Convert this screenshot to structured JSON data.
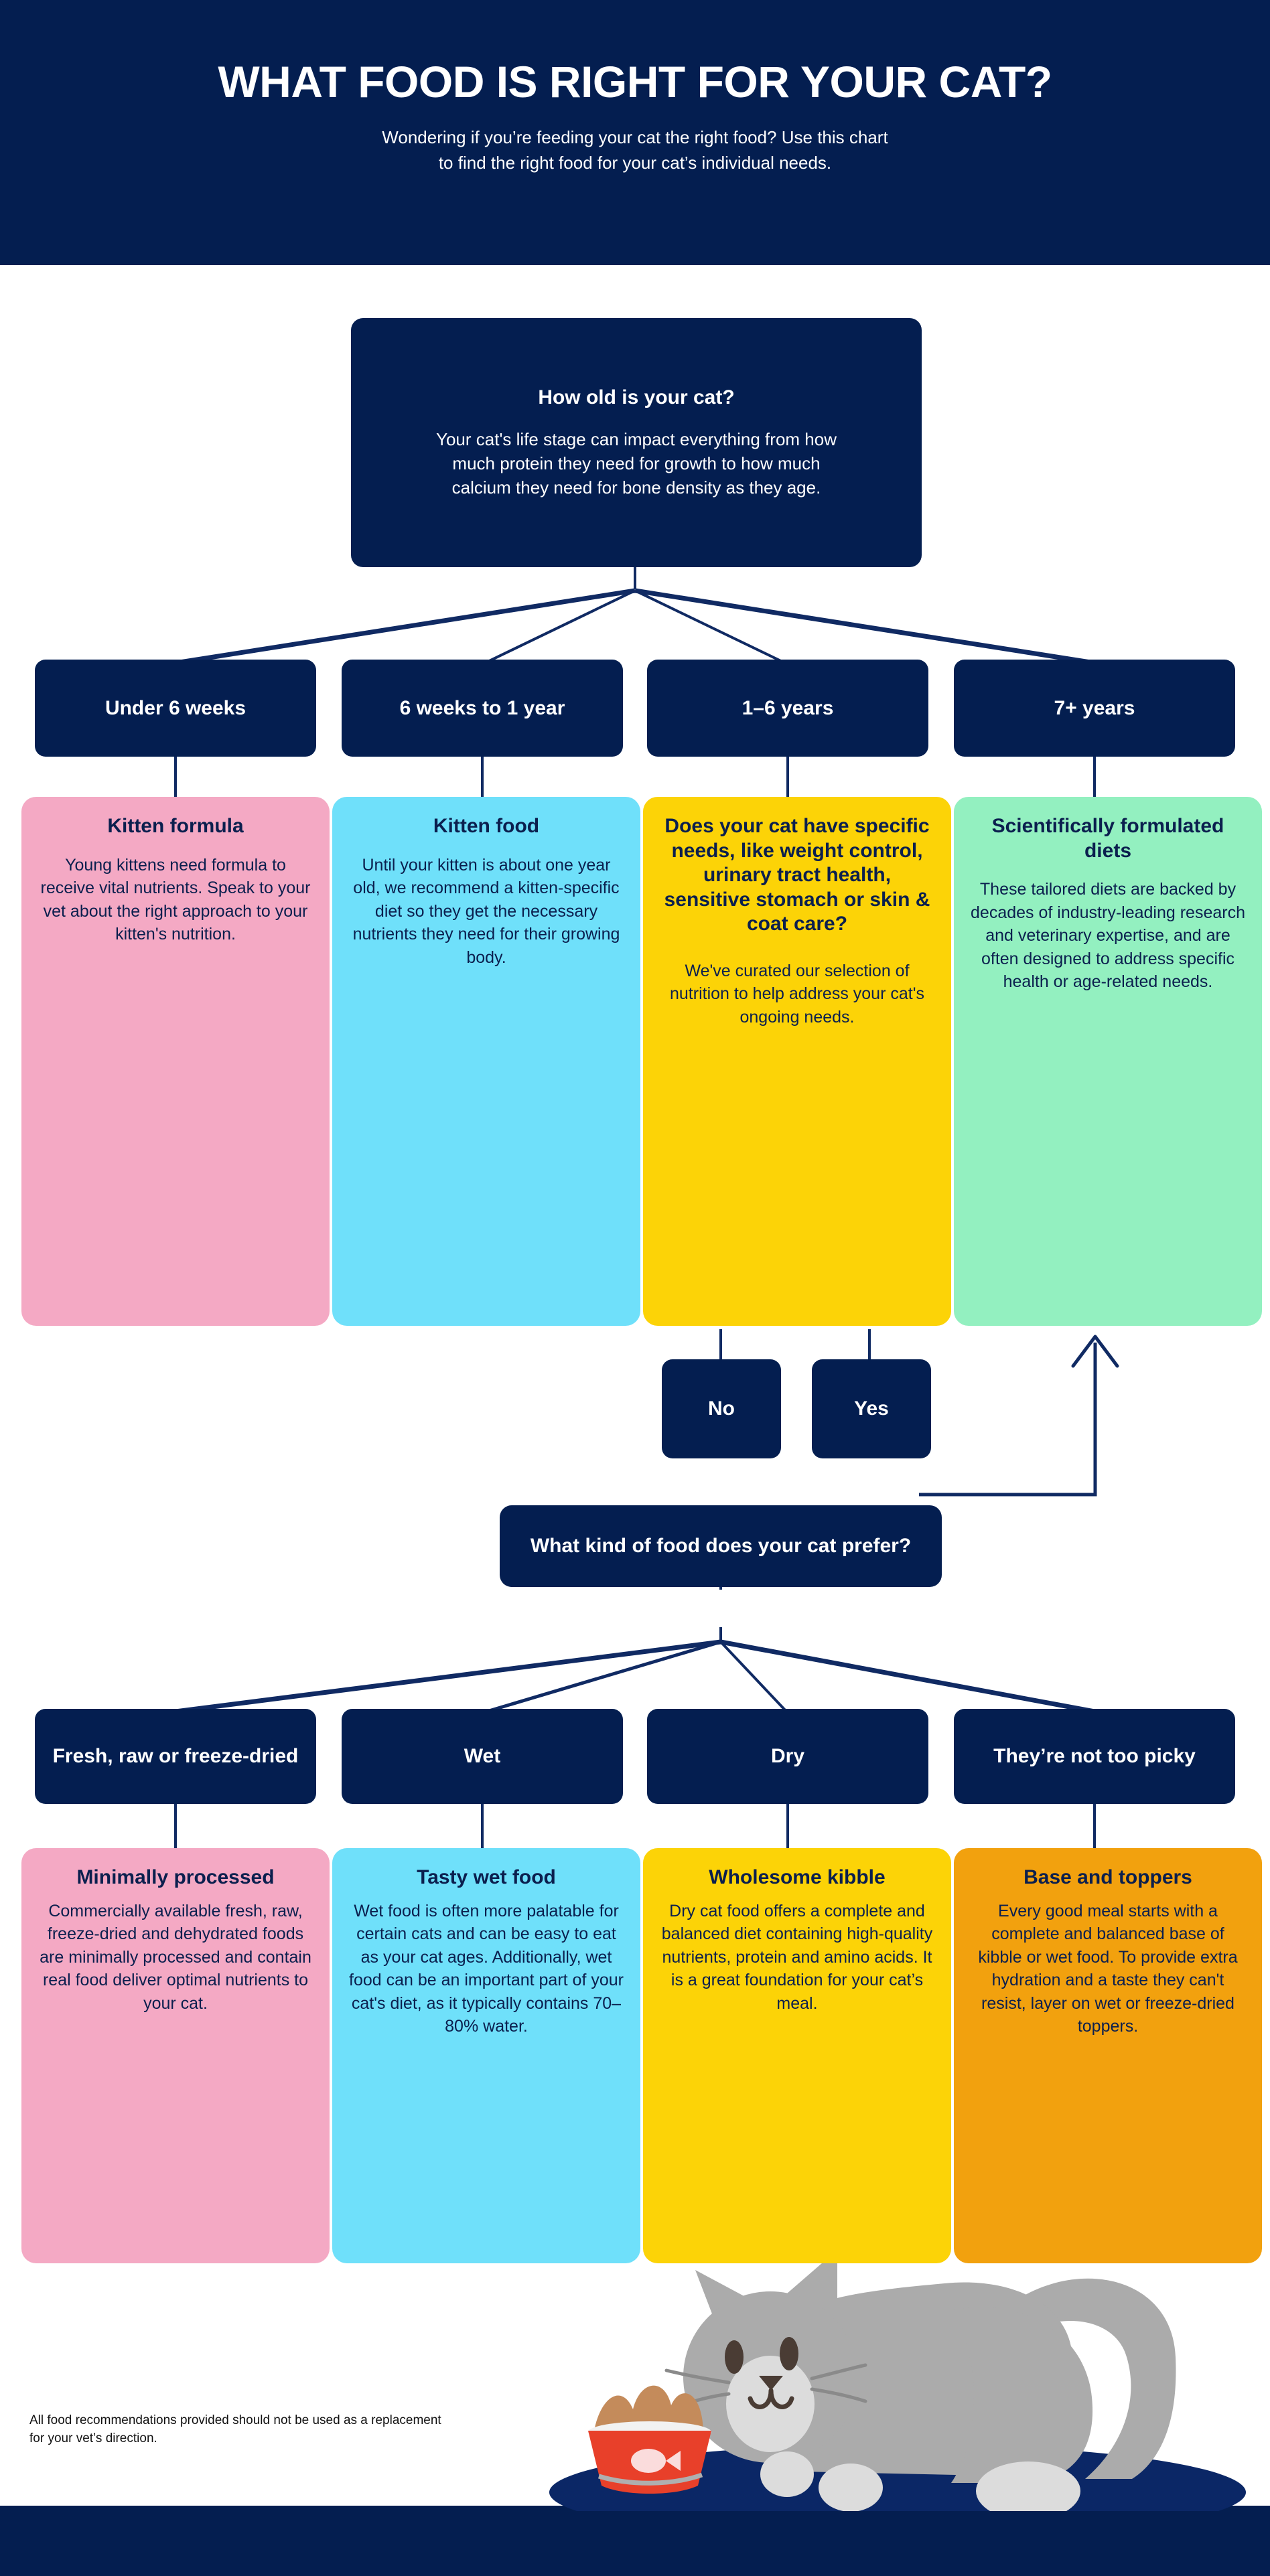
{
  "header": {
    "title": "WHAT FOOD IS RIGHT FOR YOUR CAT?",
    "subtitle_line1": "Wondering if you’re feeding your cat the right food? Use this chart",
    "subtitle_line2": "to find the right food for your cat’s individual needs."
  },
  "colors": {
    "navy": "#041E50",
    "pink": "#F4A9C4",
    "cyan": "#6FE0FA",
    "yellow": "#FCD307",
    "green": "#93F0C0",
    "orange": "#F2A10E",
    "white": "#FFFFFF",
    "text_navy": "#0B1F4E"
  },
  "root_question": {
    "title": "How old is your cat?",
    "body": "Your cat's life stage can impact everything from how much protein they need for growth to how much calcium they need for bone density as they age."
  },
  "age_options": [
    {
      "label": "Under 6 weeks"
    },
    {
      "label": "6 weeks to 1 year"
    },
    {
      "label": "1–6 years"
    },
    {
      "label": "7+ years"
    }
  ],
  "age_cards": [
    {
      "color": "pink",
      "title": "Kitten formula",
      "body": "Young kittens need formula to receive vital nutrients. Speak to your vet about the right approach to your kitten's nutrition.",
      "body2": ""
    },
    {
      "color": "cyan",
      "title": "Kitten food",
      "body": "Until your kitten is about one year old, we recommend a kitten-specific diet so they get the necessary nutrients they need for their growing body.",
      "body2": ""
    },
    {
      "color": "yellow",
      "title": "Does your cat have specific needs, like weight control, urinary tract health, sensitive stomach or skin & coat care?",
      "body": "",
      "body2": "We've curated our selection of nutrition to help address your cat's ongoing needs."
    },
    {
      "color": "green",
      "title": "Scientifically formulated diets",
      "body": "These tailored diets are backed by decades of industry-leading research and veterinary expertise, and are often designed to address specific health or age-related needs.",
      "body2": ""
    }
  ],
  "branch_answers": [
    {
      "label": "No"
    },
    {
      "label": "Yes"
    }
  ],
  "food_question": {
    "title": "What kind of food does your cat prefer?"
  },
  "food_options": [
    {
      "label": "Fresh, raw or freeze-dried"
    },
    {
      "label": "Wet"
    },
    {
      "label": "Dry"
    },
    {
      "label": "They’re not too picky"
    }
  ],
  "food_cards": [
    {
      "color": "pink",
      "title": "Minimally processed",
      "body": "Commercially available fresh, raw, freeze-dried and dehydrated foods are minimally processed and contain real food deliver optimal nutrients to your cat."
    },
    {
      "color": "cyan",
      "title": "Tasty wet food",
      "body": "Wet food is often more palatable for certain cats and can be easy to eat as your cat ages. Additionally, wet food can be an important part of your cat's diet, as it typically contains 70–80% water."
    },
    {
      "color": "yellow",
      "title": "Wholesome kibble",
      "body": "Dry cat food offers a complete and balanced diet containing high-quality nutrients, protein and amino acids. It is a great foundation for your cat’s meal."
    },
    {
      "color": "orange",
      "title": "Base and toppers",
      "body": "Every good meal starts with a complete and balanced base of kibble or wet food. To provide extra hydration and a taste they can't resist, layer on wet or freeze-dried toppers."
    }
  ],
  "footer": {
    "disclaimer": "All food recommendations provided should not be used as a replacement for your vet’s direction."
  }
}
